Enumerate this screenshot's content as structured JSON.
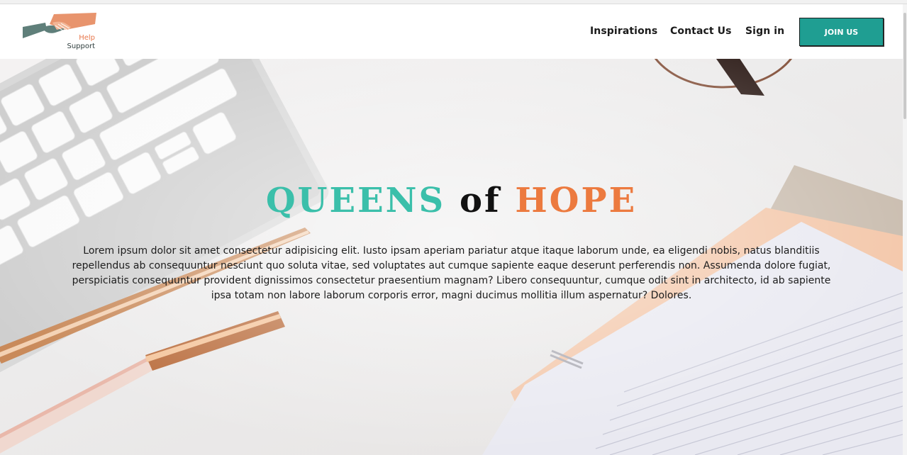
{
  "brand": {
    "logo_line1": "Help",
    "logo_line2": "Support",
    "colors": {
      "teal": "#1f9e92",
      "orange": "#ec7a3f",
      "heading_teal": "#3bbfaa"
    }
  },
  "nav": {
    "items": [
      {
        "label": "Inspirations"
      },
      {
        "label": "Contact Us"
      },
      {
        "label": "Sign in"
      }
    ],
    "cta_label": "JOIN US"
  },
  "hero": {
    "title_part1": "QUEENS",
    "title_part2": "of",
    "title_part3": "HOPE",
    "paragraph": "Lorem ipsum dolor sit amet consectetur adipisicing elit. Iusto ipsam aperiam pariatur atque itaque laborum unde, ea eligendi nobis, natus blanditiis repellendus ab consequuntur nesciunt quo soluta vitae, sed voluptates aut cumque sapiente eaque deserunt perferendis non. Assumenda dolore fugiat, perspiciatis consequuntur provident dignissimos consectetur praesentium magnam? Libero consequuntur, cumque odit sint in architecto, id ab sapiente ipsa totam non labore laborum corporis error, magni ducimus mollitia illum aspernatur? Dolores.",
    "background_image": "desk-keyboard-pens-notebook-image"
  }
}
